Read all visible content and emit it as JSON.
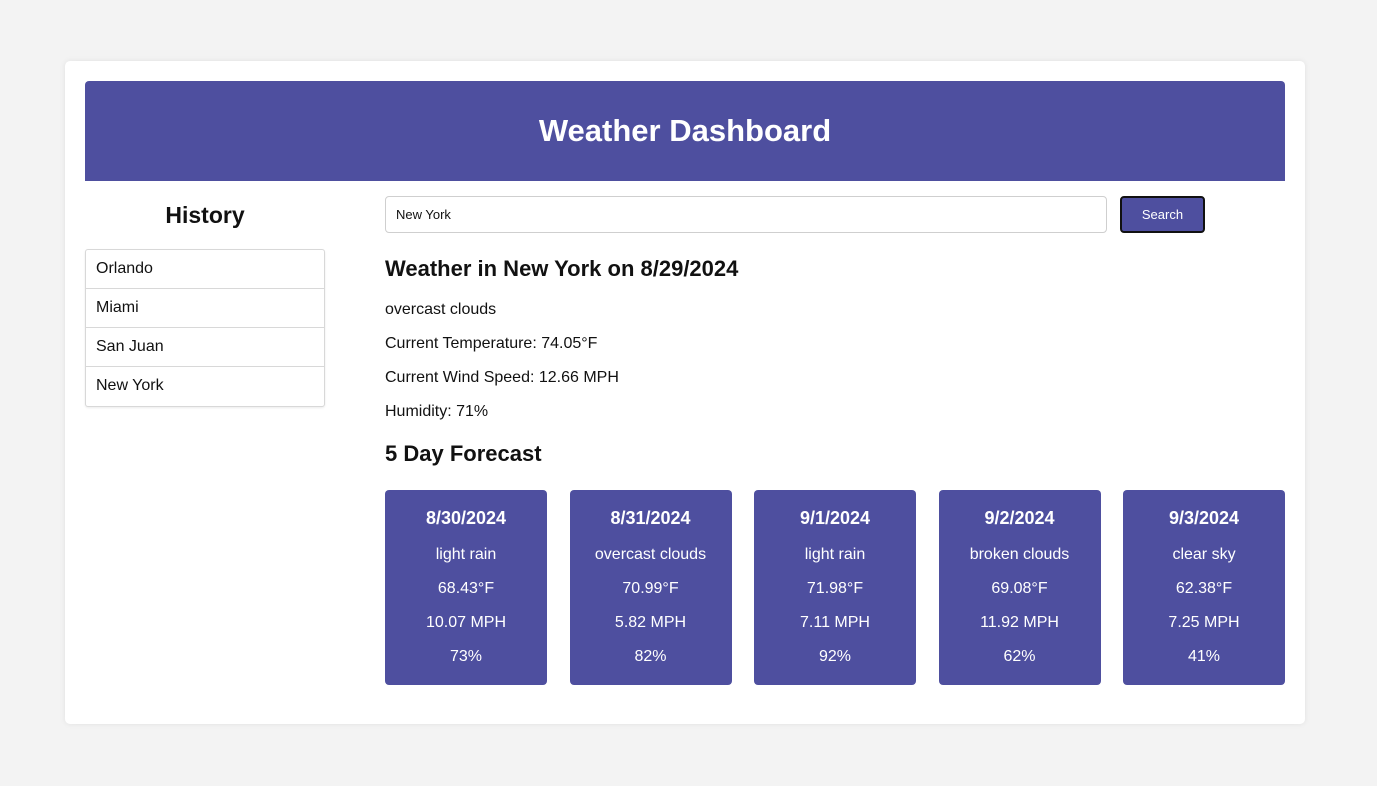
{
  "header": {
    "title": "Weather Dashboard"
  },
  "history": {
    "title": "History",
    "items": [
      "Orlando",
      "Miami",
      "San Juan",
      "New York"
    ]
  },
  "search": {
    "value": "New York",
    "button_label": "Search"
  },
  "current": {
    "title": "Weather in New York on 8/29/2024",
    "description": "overcast clouds",
    "temperature": "Current Temperature: 74.05°F",
    "wind": "Current Wind Speed: 12.66 MPH",
    "humidity": "Humidity: 71%"
  },
  "forecast": {
    "title": "5 Day Forecast",
    "days": [
      {
        "date": "8/30/2024",
        "description": "light rain",
        "temp": "68.43°F",
        "wind": "10.07 MPH",
        "humidity": "73%"
      },
      {
        "date": "8/31/2024",
        "description": "overcast clouds",
        "temp": "70.99°F",
        "wind": "5.82 MPH",
        "humidity": "82%"
      },
      {
        "date": "9/1/2024",
        "description": "light rain",
        "temp": "71.98°F",
        "wind": "7.11 MPH",
        "humidity": "92%"
      },
      {
        "date": "9/2/2024",
        "description": "broken clouds",
        "temp": "69.08°F",
        "wind": "11.92 MPH",
        "humidity": "62%"
      },
      {
        "date": "9/3/2024",
        "description": "clear sky",
        "temp": "62.38°F",
        "wind": "7.25 MPH",
        "humidity": "41%"
      }
    ]
  },
  "colors": {
    "accent": "#4e4f9f",
    "page_background": "#f3f3f3",
    "card_background": "#ffffff"
  }
}
